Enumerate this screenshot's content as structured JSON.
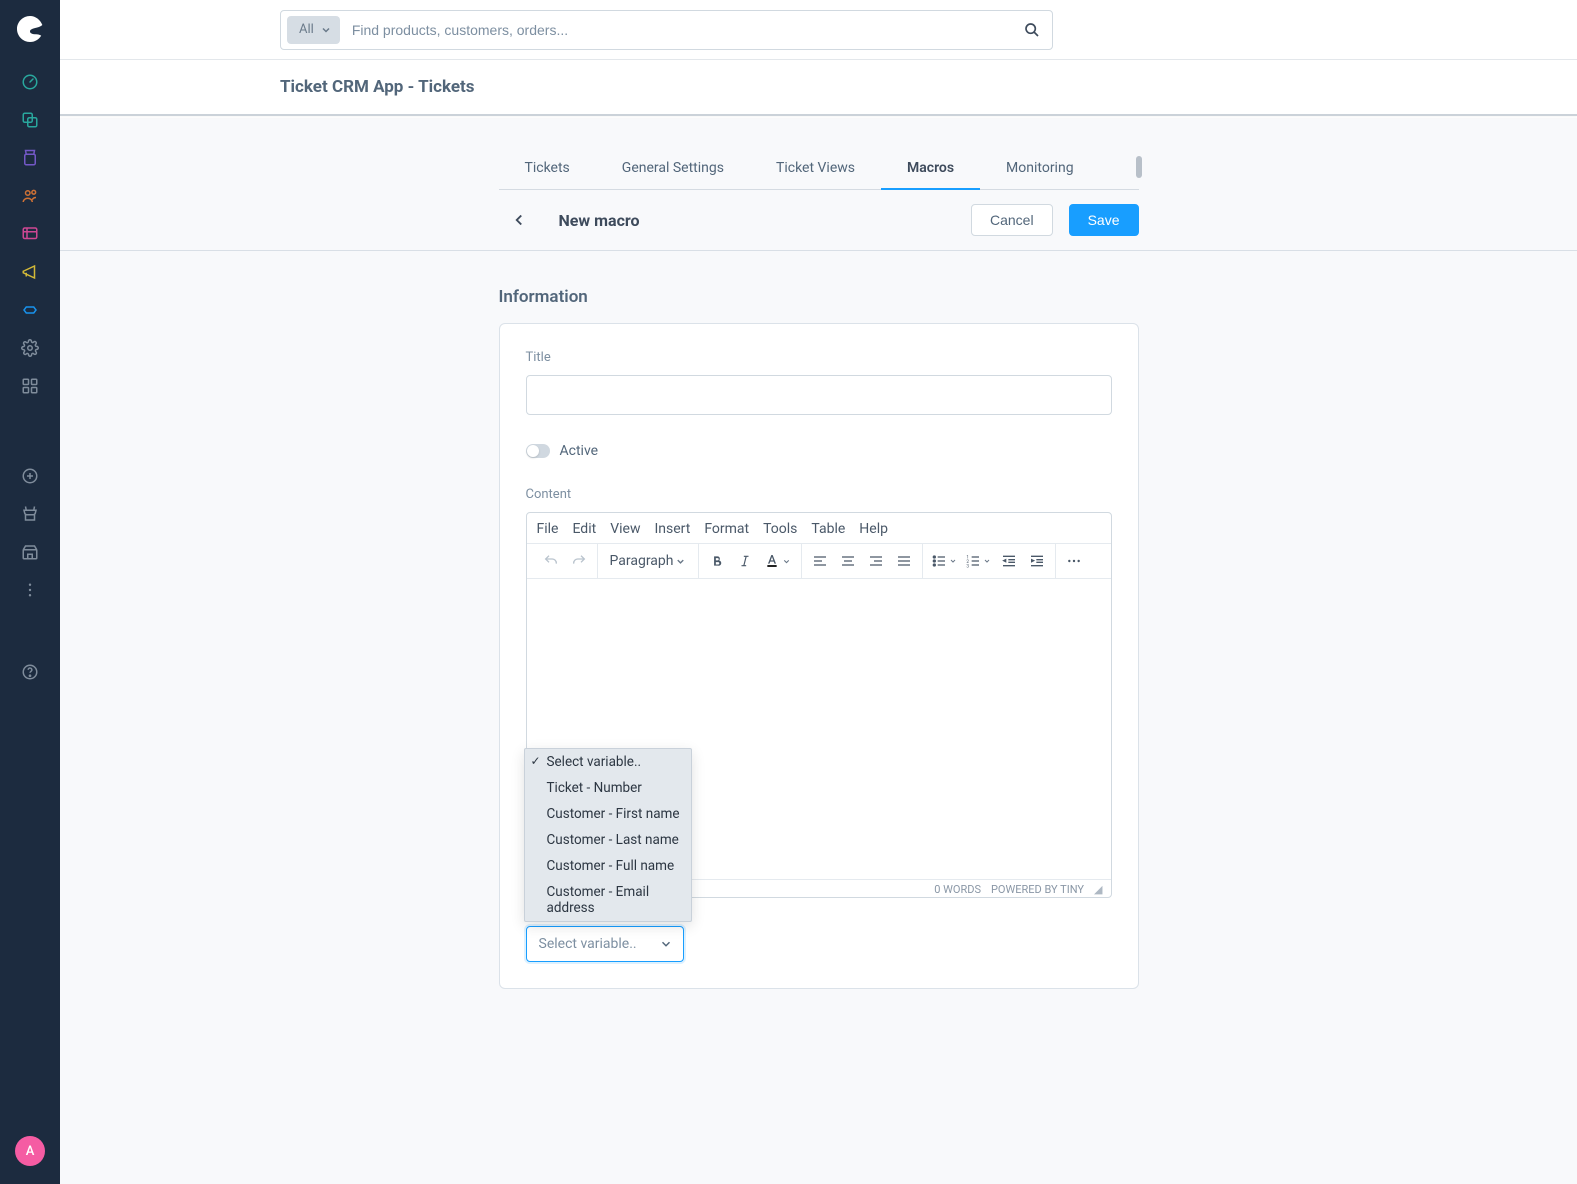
{
  "search": {
    "filter_label": "All",
    "placeholder": "Find products, customers, orders..."
  },
  "page_title": "Ticket CRM App - Tickets",
  "tabs": [
    {
      "label": "Tickets"
    },
    {
      "label": "General Settings"
    },
    {
      "label": "Ticket Views"
    },
    {
      "label": "Macros"
    },
    {
      "label": "Monitoring"
    }
  ],
  "subheader": {
    "title": "New macro",
    "cancel": "Cancel",
    "save": "Save"
  },
  "section_title": "Information",
  "form": {
    "title_label": "Title",
    "title_value": "",
    "active_label": "Active",
    "content_label": "Content"
  },
  "editor": {
    "menus": [
      "File",
      "Edit",
      "View",
      "Insert",
      "Format",
      "Tools",
      "Table",
      "Help"
    ],
    "paragraph": "Paragraph",
    "status_words": "0 WORDS",
    "status_powered": "POWERED BY TINY"
  },
  "variable_select": {
    "placeholder": "Select variable..",
    "options": [
      "Select variable..",
      "Ticket - Number",
      "Customer - First name",
      "Customer - Last name",
      "Customer - Full name",
      "Customer - Email address"
    ]
  },
  "avatar_initial": "A"
}
